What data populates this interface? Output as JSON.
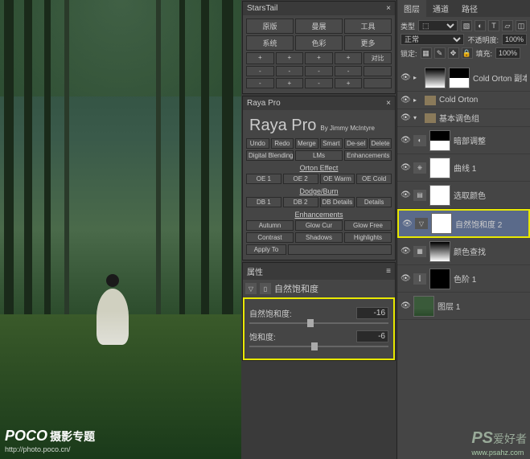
{
  "watermark_left": {
    "brand": "POCO",
    "topic": "摄影专题",
    "url": "http://photo.poco.cn/"
  },
  "watermark_right": {
    "brand": "PS",
    "cn": "爱好者",
    "url": "www.psahz.com"
  },
  "starstail": {
    "title": "StarsTail",
    "rows": [
      [
        "原版",
        "曼展",
        "工具"
      ],
      [
        "系统",
        "色彩",
        "更多"
      ]
    ]
  },
  "rayapro": {
    "title": "Raya Pro",
    "by": "By Jimmy McIntyre",
    "row1": [
      "Undo",
      "Redo",
      "Merge",
      "Smart",
      "De-sel",
      "Delete"
    ],
    "row2": [
      "Digital Blending",
      "LMs",
      "Enhancements"
    ],
    "orton_label": "Orton Effect",
    "orton": [
      "OE 1",
      "OE 2",
      "OE Warm",
      "OE Cold"
    ],
    "dodge_label": "Dodge/Burn",
    "dodge": [
      "DB 1",
      "DB 2",
      "DB Details",
      "Details"
    ],
    "enh_label": "Enhancements",
    "enh1": [
      "Autumn",
      "Glow Cur",
      "Glow Free"
    ],
    "enh2": [
      "Contrast",
      "Shadows",
      "Highlights"
    ],
    "apply": "Apply To"
  },
  "properties": {
    "tab": "属性",
    "title": "自然饱和度",
    "slider1": {
      "label": "自然饱和度:",
      "value": "-16",
      "pos": 44
    },
    "slider2": {
      "label": "饱和度:",
      "value": "-6",
      "pos": 47
    }
  },
  "layers_panel": {
    "tabs": [
      "图层",
      "通道",
      "路径"
    ],
    "kind": "类型",
    "blend": "正常",
    "opacity_label": "不透明度:",
    "opacity_val": "100%",
    "lock_label": "锁定:",
    "fill_label": "填充:",
    "fill_val": "100%",
    "layers": [
      {
        "type": "adj",
        "name": "Cold Orton 副本"
      },
      {
        "type": "group",
        "name": "Cold Orton"
      },
      {
        "type": "group",
        "name": "基本调色组",
        "open": true
      },
      {
        "type": "adj",
        "name": "暗部调整",
        "indent": true
      },
      {
        "type": "adj",
        "name": "曲线 1",
        "indent": true
      },
      {
        "type": "adj",
        "name": "选取颜色",
        "indent": true
      },
      {
        "type": "adj",
        "name": "自然饱和度 2",
        "indent": true,
        "selected": true
      },
      {
        "type": "adj",
        "name": "颜色查找",
        "indent": true
      },
      {
        "type": "adj",
        "name": "色阶 1",
        "indent": true
      },
      {
        "type": "img",
        "name": "图层 1"
      }
    ]
  }
}
